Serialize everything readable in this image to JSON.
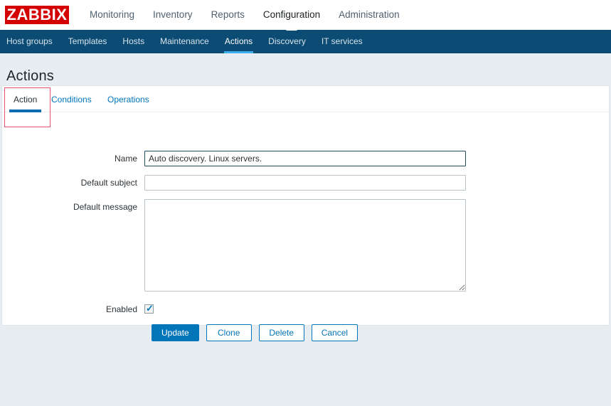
{
  "brand": {
    "logo_text": "ZABBIX",
    "logo_bg": "#d40000",
    "logo_fg": "#ffffff"
  },
  "theme": {
    "page_bg": "#e8edf1",
    "subnav_bg": "#0c4b74",
    "accent": "#0275b8",
    "active_tab_underline": "#0a6cb0",
    "subnav_active_underline": "#3daee9",
    "highlight_box": "#e8516a"
  },
  "main_nav": {
    "items": [
      {
        "label": "Monitoring",
        "selected": false
      },
      {
        "label": "Inventory",
        "selected": false
      },
      {
        "label": "Reports",
        "selected": false
      },
      {
        "label": "Configuration",
        "selected": true
      },
      {
        "label": "Administration",
        "selected": false
      }
    ]
  },
  "sub_nav": {
    "items": [
      {
        "label": "Host groups",
        "selected": false
      },
      {
        "label": "Templates",
        "selected": false
      },
      {
        "label": "Hosts",
        "selected": false
      },
      {
        "label": "Maintenance",
        "selected": false
      },
      {
        "label": "Actions",
        "selected": true
      },
      {
        "label": "Discovery",
        "selected": false
      },
      {
        "label": "IT services",
        "selected": false
      }
    ]
  },
  "page": {
    "title": "Actions"
  },
  "tabs": [
    {
      "label": "Action",
      "active": true
    },
    {
      "label": "Conditions",
      "active": false
    },
    {
      "label": "Operations",
      "active": false
    }
  ],
  "form": {
    "name": {
      "label": "Name",
      "value": "Auto discovery. Linux servers.",
      "placeholder": "",
      "focused": true
    },
    "default_subject": {
      "label": "Default subject",
      "value": "",
      "placeholder": ""
    },
    "default_message": {
      "label": "Default message",
      "value": "",
      "placeholder": ""
    },
    "enabled": {
      "label": "Enabled",
      "checked": true,
      "tick_glyph": "✓"
    }
  },
  "buttons": [
    {
      "label": "Update",
      "style": "primary"
    },
    {
      "label": "Clone",
      "style": "secondary"
    },
    {
      "label": "Delete",
      "style": "secondary"
    },
    {
      "label": "Cancel",
      "style": "secondary"
    }
  ]
}
